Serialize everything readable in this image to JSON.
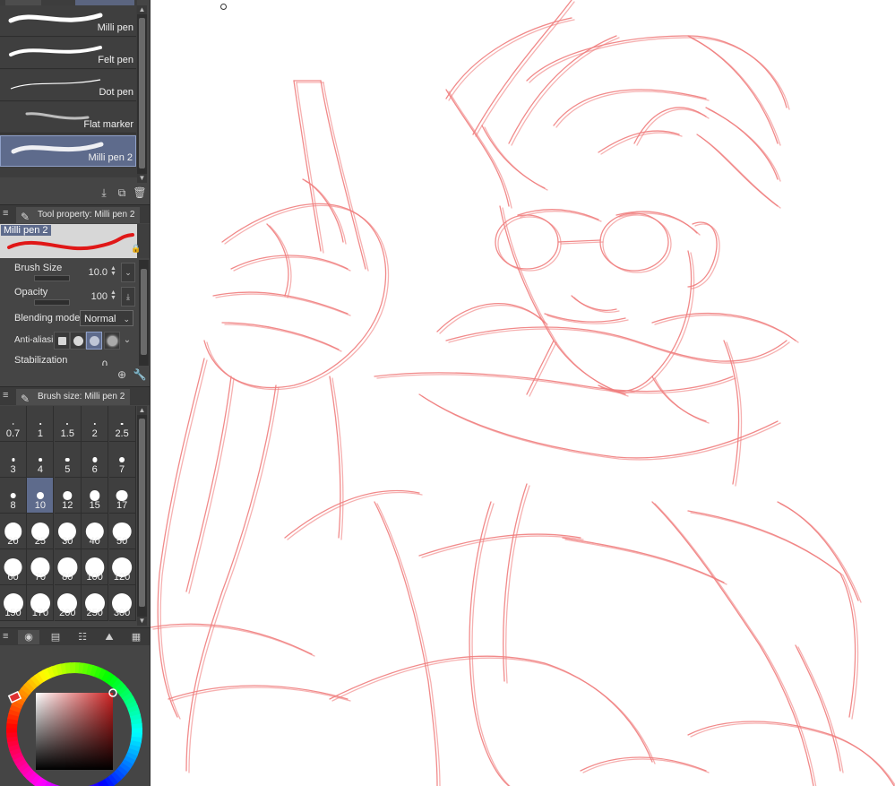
{
  "brush_list": {
    "items": [
      {
        "label": "Milli pen",
        "selected": false
      },
      {
        "label": "Felt pen",
        "selected": false
      },
      {
        "label": "Dot pen",
        "selected": false
      },
      {
        "label": "Flat marker",
        "selected": false
      },
      {
        "label": "Milli pen 2",
        "selected": true
      }
    ],
    "action_icons": [
      "import-icon",
      "duplicate-icon",
      "trash-icon"
    ]
  },
  "tool_property": {
    "tab_label": "Tool property: Milli pen 2",
    "preview_name": "Milli pen 2",
    "brush_size_label": "Brush Size",
    "brush_size_value": "10.0",
    "opacity_label": "Opacity",
    "opacity_value": "100",
    "blending_label": "Blending mode",
    "blending_value": "Normal",
    "antialias_label": "Anti-aliasin",
    "stabilization_label": "Stabilization",
    "stabilization_value": "0"
  },
  "brush_size": {
    "tab_label": "Brush size: Milli pen 2",
    "sizes": [
      "0.7",
      "1",
      "1.5",
      "2",
      "2.5",
      "3",
      "4",
      "5",
      "6",
      "7",
      "8",
      "10",
      "12",
      "15",
      "17",
      "20",
      "25",
      "30",
      "40",
      "50",
      "60",
      "70",
      "80",
      "100",
      "120",
      "150",
      "170",
      "200",
      "250",
      "300"
    ],
    "selected": "10"
  },
  "colors": {
    "panel_bg": "#454545",
    "selection": "#5e6b8c",
    "sketch_stroke": "#f07d7d",
    "main_color": "#cc2222"
  }
}
